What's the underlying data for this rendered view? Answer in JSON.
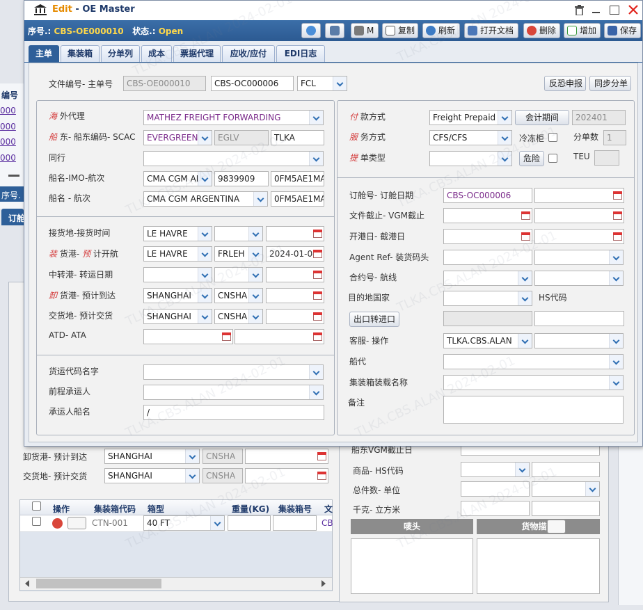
{
  "window": {
    "title_edit": "Edit",
    "title_sep": " - ",
    "title_name": "OE Master",
    "seq_label": "序号.:",
    "seq_value": "CBS-OE000010",
    "status_label": "状态.:",
    "status_value": "Open"
  },
  "toolbar": {
    "print_label": "M",
    "copy_label": "复制",
    "refresh_label": "刷新",
    "open_doc_label": "打开文档",
    "delete_label": "删除",
    "add_label": "增加",
    "save_label": "保存"
  },
  "tabs": [
    "主单",
    "集装箱",
    "分单列",
    "成本",
    "票据代理",
    "应收/应付",
    "EDI日志"
  ],
  "file_row": {
    "label": "文件编号- 主单号",
    "file_no": "CBS-OE000010",
    "master_no": "CBS-OC000006",
    "mode": "FCL",
    "btn_declare": "反恐申报",
    "btn_sync": "同步分单"
  },
  "left": {
    "agent_label_a": "海",
    "agent_label_b": " 外代理",
    "agent_value": "MATHEZ FREIGHT FORWARDING",
    "carrier_label_a": "船",
    "carrier_label_b": " 东- 船东编码- SCAC",
    "carrier_value": "EVERGREEN",
    "carrier_code": "EGLV",
    "scac": "TLKA",
    "peer_label": "同行",
    "vessel_imo_label": "船名-IMO-航次",
    "vessel1": "CMA CGM AR",
    "imo": "9839909",
    "voyage1": "0FM5AE1MA",
    "vessel_voy_label": "船名 - 航次",
    "vessel2": "CMA CGM ARGENTINA",
    "voyage2": "0FM5AE1MA",
    "receipt_label": "接货地-接货时间",
    "receipt_value": "LE HAVRE",
    "pol_label_a": "装",
    "pol_label_b": " 货港- ",
    "pol_label_c": "预",
    "pol_label_d": " 计开航",
    "pol_value": "LE HAVRE",
    "pol_code": "FRLEH",
    "etd": "2024-01-04",
    "transit_label": "中转港- 转运日期",
    "pod_label_a": "卸",
    "pod_label_b": " 货港- 预计到达",
    "pod_value": "SHANGHAI",
    "pod_code": "CNSHA",
    "delivery_label": "交货地- 预计交货",
    "delivery_value": "SHANGHAI",
    "delivery_code": "CNSHA",
    "atd_label": "ATD- ATA",
    "forwarder_label": "货运代码名字",
    "pre_carrier_label": "前程承运人",
    "carrier_vessel_label": "承运人船名",
    "carrier_vessel_value": "/"
  },
  "right": {
    "payment_label_a": "付",
    "payment_label_b": " 款方式",
    "payment_value": "Freight Prepaid",
    "period_btn": "会计期间",
    "period_value": "202401",
    "service_label_a": "服",
    "service_label_b": " 务方式",
    "service_value": "CFS/CFS",
    "reefer_label": "冷冻柜",
    "split_label": "分单数",
    "split_value": "1",
    "bl_label_a": "提",
    "bl_label_b": " 单类型",
    "danger_btn": "危险",
    "teu_label": "TEU",
    "booking_label": "订舱号- 订舱日期",
    "booking_value": "CBS-OC000006",
    "doc_cutoff_label": "文件截止- VGM截止",
    "open_label": "开港日- 截港日",
    "agent_ref_label": "Agent Ref- 装货码头",
    "contract_label": "合约号- 航线",
    "dest_country_label": "目的地国家",
    "hs_label": "HS代码",
    "export_btn": "出口转进口",
    "cs_label": "客服- 操作",
    "cs_value": "TLKA.CBS.ALAN",
    "shipping_agent_label": "船代",
    "cy_label": "集装箱装载名称",
    "remark_label": "备注"
  },
  "background": {
    "pod_label": "卸货港- 预计到达",
    "pod_value": "SHANGHAI",
    "pod_code": "CNSHA",
    "delivery_label": "交货地- 预计交货",
    "delivery_value": "SHANGHAI",
    "delivery_code": "CNSHA",
    "vgm_label": "船东VGM截止日",
    "goods_label": "商品- HS代码",
    "qty_label": "总件数- 单位",
    "weight_label": "千克- 立方米",
    "marks_header": "唛头",
    "desc_header": "货物描述",
    "table_headers": [
      "操作",
      "集装箱代码",
      "箱型",
      "重量(KG)",
      "集装箱号",
      "文"
    ],
    "row": {
      "container_code": "CTN-001",
      "type": "40 FT",
      "last": "CB"
    },
    "side_labels": [
      "编号",
      "序号.",
      "订舱"
    ],
    "side_links": [
      "000",
      "000",
      "000",
      "000"
    ]
  },
  "watermark": "TLKA.CBS.ALAN 2024-02-01"
}
